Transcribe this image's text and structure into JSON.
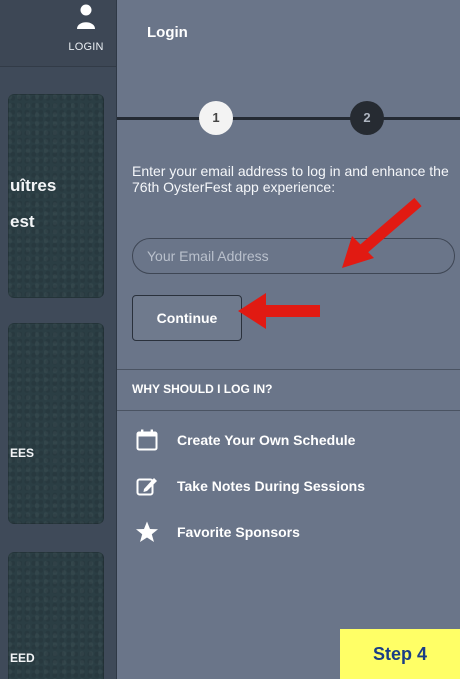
{
  "left_app": {
    "nav_login_label": "LOGIN",
    "cards": [
      {
        "line1": "uîtres",
        "line2": "est"
      },
      {
        "line1": "EES"
      },
      {
        "line1": "EED"
      }
    ]
  },
  "login_panel": {
    "title": "Login",
    "steps": [
      "1",
      "2"
    ],
    "intro_text": "Enter your email address to log in and enhance the 76th OysterFest app experience:",
    "email_placeholder": "Your Email Address",
    "continue_label": "Continue",
    "why_heading": "WHY SHOULD I LOG IN?",
    "benefits": [
      {
        "icon": "calendar-icon",
        "label": "Create Your Own Schedule"
      },
      {
        "icon": "edit-note-icon",
        "label": "Take Notes During Sessions"
      },
      {
        "icon": "star-icon",
        "label": "Favorite Sponsors"
      }
    ]
  },
  "overlay": {
    "step_badge": "Step 4",
    "arrow_color": "#e11a12",
    "badge_color": "#ffff66"
  }
}
